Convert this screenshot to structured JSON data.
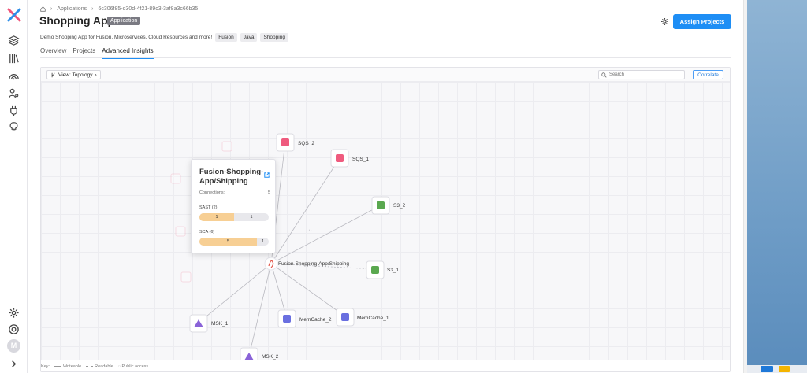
{
  "breadcrumb": {
    "home_icon": "home-icon",
    "section": "Applications",
    "app_id": "6c306f85-d30d-4f21-89c3-3af8a3c66b35"
  },
  "header": {
    "title": "Shopping App",
    "badge": "Application",
    "description": "Demo Shopping App for Fusion, Microservices, Cloud Resources and more!",
    "tags": [
      "Fusion",
      "Java",
      "Shopping"
    ],
    "assign_label": "Assign Projects"
  },
  "tabs": [
    {
      "label": "Overview",
      "active": false
    },
    {
      "label": "Projects",
      "active": false
    },
    {
      "label": "Advanced Insights",
      "active": true
    }
  ],
  "toolbar": {
    "view_label": "View: Topology",
    "search_placeholder": "Search",
    "correlate_label": "Correlate"
  },
  "graph": {
    "center_label": "Fusion-Shopping-App/Shipping",
    "nodes": [
      {
        "label": "SQS_2",
        "kind": "sqs"
      },
      {
        "label": "SQS_1",
        "kind": "sqs"
      },
      {
        "label": "S3_2",
        "kind": "s3"
      },
      {
        "label": "S3_1",
        "kind": "s3"
      },
      {
        "label": "MemCache_1",
        "kind": "memcache"
      },
      {
        "label": "MemCache_2",
        "kind": "memcache"
      },
      {
        "label": "MSK_1",
        "kind": "msk"
      },
      {
        "label": "MSK_2",
        "kind": "msk"
      }
    ]
  },
  "popup": {
    "title": "Fusion-Shopping-App/Shipping",
    "connections_label": "Connections:",
    "connections_value": "5",
    "sast_label": "SAST (2)",
    "sast_left": "1",
    "sast_right": "1",
    "sast_fraction": 0.5,
    "sca_label": "SCA (6)",
    "sca_left": "5",
    "sca_right": "1",
    "sca_fraction": 0.83
  },
  "legend": {
    "key": "Key:",
    "writeable": "Writeable",
    "readable": "Readable",
    "public": "Public access"
  },
  "colors": {
    "accent": "#1e8ef5",
    "sqs": "#ef5b7e",
    "s3": "#5aa84f",
    "memcache": "#6a6fe0",
    "msk": "#8a63d8",
    "sast_bar": "#f7cf94"
  }
}
